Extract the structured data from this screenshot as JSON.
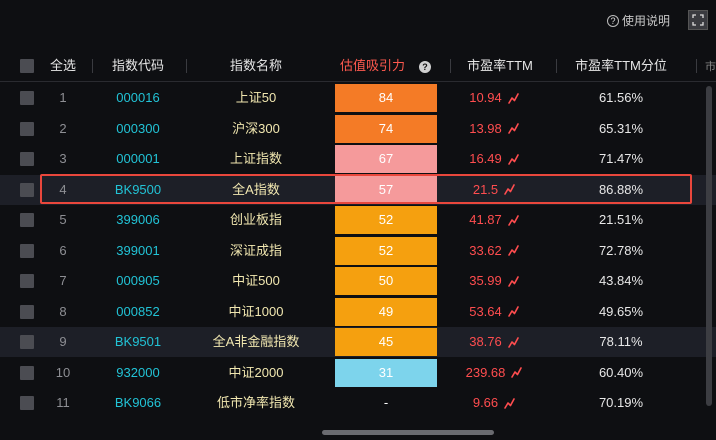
{
  "help_text": "使用说明",
  "header": {
    "select_all": "全选",
    "code": "指数代码",
    "name": "指数名称",
    "valuation": "估值吸引力",
    "pe": "市盈率TTM",
    "pe_percentile": "市盈率TTM分位",
    "overflow": "市"
  },
  "colors": {
    "orange_dark": "#f47b26",
    "pink": "#f59a9b",
    "orange": "#f5a00f",
    "light_blue": "#7dd4ec",
    "highlight_border": "#e9473c"
  },
  "rows": [
    {
      "num": "1",
      "code": "000016",
      "name": "上证50",
      "valuation": "84",
      "pe": "10.94",
      "pct": "61.56%",
      "color": "#f47b26"
    },
    {
      "num": "2",
      "code": "000300",
      "name": "沪深300",
      "valuation": "74",
      "pe": "13.98",
      "pct": "65.31%",
      "color": "#f47b26"
    },
    {
      "num": "3",
      "code": "000001",
      "name": "上证指数",
      "valuation": "67",
      "pe": "16.49",
      "pct": "71.47%",
      "color": "#f59a9b"
    },
    {
      "num": "4",
      "code": "BK9500",
      "name": "全A指数",
      "valuation": "57",
      "pe": "21.5",
      "pct": "86.88%",
      "color": "#f59a9b"
    },
    {
      "num": "5",
      "code": "399006",
      "name": "创业板指",
      "valuation": "52",
      "pe": "41.87",
      "pct": "21.51%",
      "color": "#f5a00f"
    },
    {
      "num": "6",
      "code": "399001",
      "name": "深证成指",
      "valuation": "52",
      "pe": "33.62",
      "pct": "72.78%",
      "color": "#f5a00f"
    },
    {
      "num": "7",
      "code": "000905",
      "name": "中证500",
      "valuation": "50",
      "pe": "35.99",
      "pct": "43.84%",
      "color": "#f5a00f"
    },
    {
      "num": "8",
      "code": "000852",
      "name": "中证1000",
      "valuation": "49",
      "pe": "53.64",
      "pct": "49.65%",
      "color": "#f5a00f"
    },
    {
      "num": "9",
      "code": "BK9501",
      "name": "全A非金融指数",
      "valuation": "45",
      "pe": "38.76",
      "pct": "78.11%",
      "color": "#f5a00f"
    },
    {
      "num": "10",
      "code": "932000",
      "name": "中证2000",
      "valuation": "31",
      "pe": "239.68",
      "pct": "60.40%",
      "color": "#7dd4ec"
    },
    {
      "num": "11",
      "code": "BK9066",
      "name": "低市净率指数",
      "valuation": "-",
      "pe": "9.66",
      "pct": "70.19%",
      "color": ""
    }
  ]
}
